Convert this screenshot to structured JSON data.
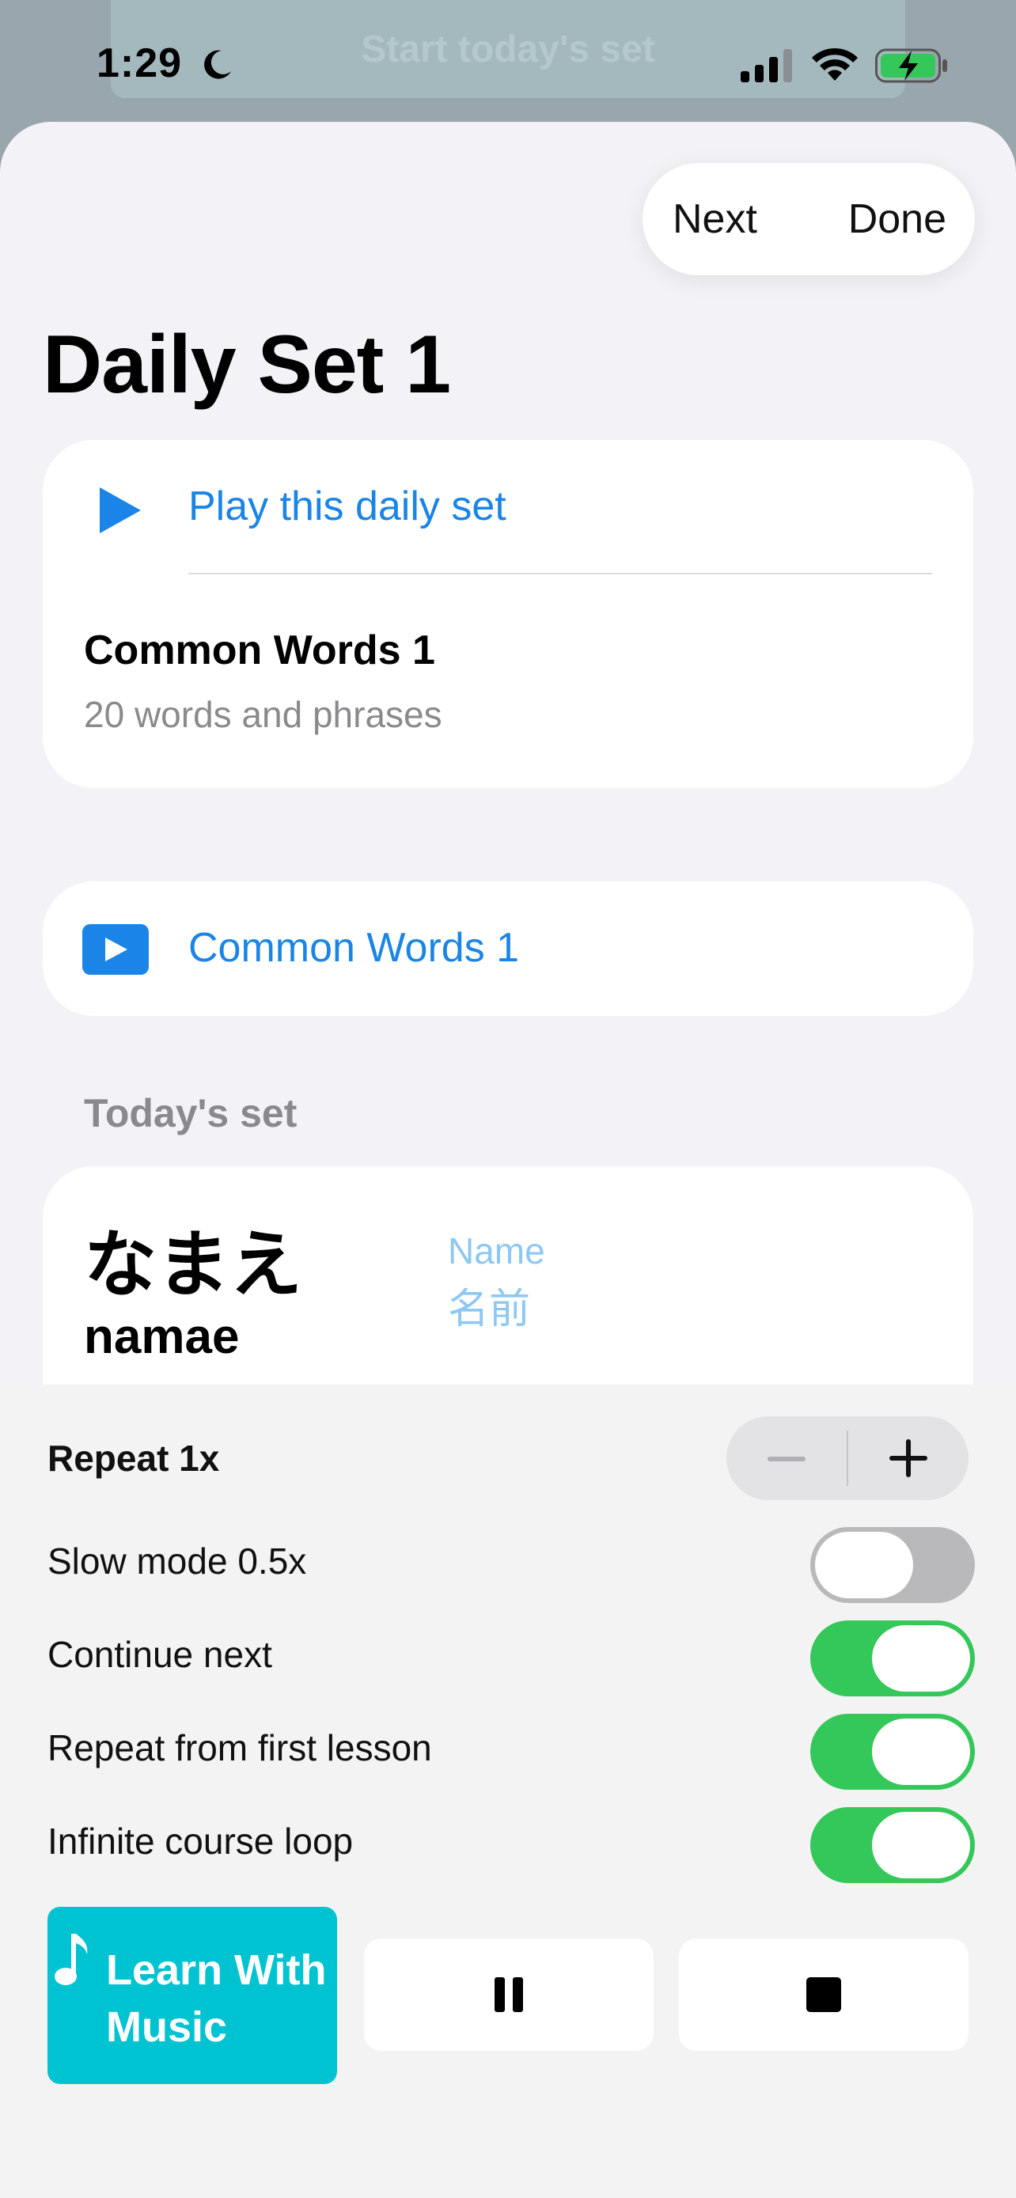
{
  "background": {
    "banner_text": "Start today's set"
  },
  "status_bar": {
    "time": "1:29",
    "icons": [
      "moon-icon",
      "cellular-signal-icon",
      "wifi-icon",
      "battery-charging-icon"
    ]
  },
  "nav": {
    "next_label": "Next",
    "done_label": "Done"
  },
  "page": {
    "title": "Daily Set 1"
  },
  "daily_set_card": {
    "play_label": "Play this daily set",
    "set_name": "Common Words 1",
    "set_subtitle": "20 words and phrases"
  },
  "lesson_card": {
    "label": "Common Words 1"
  },
  "todays_set": {
    "heading": "Today's set",
    "items": [
      {
        "kana": "なまえ",
        "romaji": "namae",
        "meaning": "Name",
        "kanji": "名前"
      }
    ]
  },
  "controls": {
    "repeat_label": "Repeat 1x",
    "toggles": [
      {
        "label": "Slow mode 0.5x",
        "on": false
      },
      {
        "label": "Continue next",
        "on": true
      },
      {
        "label": "Repeat from first lesson",
        "on": true
      },
      {
        "label": "Infinite course loop",
        "on": true
      }
    ],
    "music_button_label": "Learn With Music"
  },
  "colors": {
    "accent_blue": "#1a85e6",
    "toggle_on": "#34c759",
    "music_button": "#00c3d1",
    "secondary_text": "#8a8a8e"
  }
}
